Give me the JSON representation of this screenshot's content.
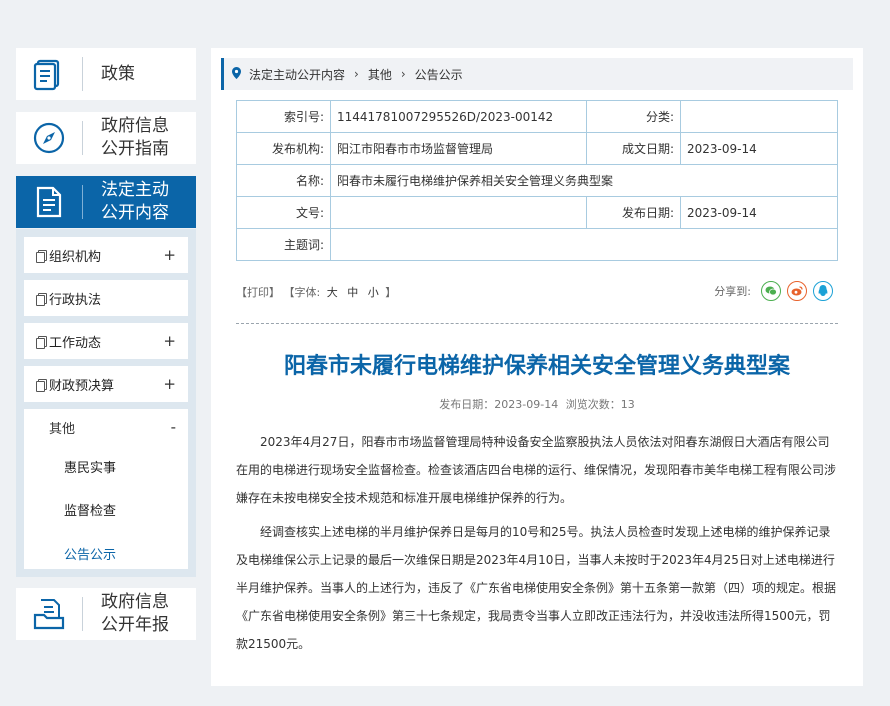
{
  "sidebar": {
    "policy": "政策",
    "guide_l1": "政府信息",
    "guide_l2": "公开指南",
    "active_l1": "法定主动",
    "active_l2": "公开内容",
    "annual_l1": "政府信息",
    "annual_l2": "公开年报",
    "menu": [
      {
        "label": "组织机构",
        "toggle": "+"
      },
      {
        "label": "行政执法",
        "toggle": ""
      },
      {
        "label": "工作动态",
        "toggle": "+"
      },
      {
        "label": "财政预决算",
        "toggle": "+"
      }
    ],
    "open_menu": {
      "label": "其他",
      "toggle": "-",
      "subs": [
        "惠民实事",
        "监督检查",
        "公告公示"
      ]
    }
  },
  "breadcrumb": [
    "法定主动公开内容",
    "其他",
    "公告公示"
  ],
  "meta": {
    "index_label": "索引号:",
    "index_value": "11441781007295526D/2023-00142",
    "category_label": "分类:",
    "category_value": "",
    "publisher_label": "发布机构:",
    "publisher_value": "阳江市阳春市市场监督管理局",
    "created_label": "成文日期:",
    "created_value": "2023-09-14",
    "name_label": "名称:",
    "name_value": "阳春市未履行电梯维护保养相关安全管理义务典型案",
    "docno_label": "文号:",
    "docno_value": "",
    "pubdate_label": "发布日期:",
    "pubdate_value": "2023-09-14",
    "subject_label": "主题词:",
    "subject_value": ""
  },
  "tools": {
    "print": "【打印】",
    "font_open": "【字体:",
    "font_big": "大",
    "font_mid": "中",
    "font_small": "小",
    "font_close": "】",
    "share_label": "分享到:"
  },
  "colors": {
    "accent": "#0b65a8",
    "wechat": "#4caf50",
    "weibo": "#e8622c",
    "qq": "#1ba1d6"
  },
  "article": {
    "title": "阳春市未履行电梯维护保养相关安全管理义务典型案",
    "date": "发布日期：2023-09-14",
    "views": "浏览次数：13",
    "p1": "2023年4月27日，阳春市市场监督管理局特种设备安全监察股执法人员依法对阳春东湖假日大酒店有限公司在用的电梯进行现场安全监督检查。检查该酒店四台电梯的运行、维保情况，发现阳春市美华电梯工程有限公司涉嫌存在未按电梯安全技术规范和标准开展电梯维护保养的行为。",
    "p2": "经调查核实上述电梯的半月维护保养日是每月的10号和25号。执法人员检查时发现上述电梯的维护保养记录及电梯维保公示上记录的最后一次维保日期是2023年4月10日，当事人未按时于2023年4月25日对上述电梯进行半月维护保养。当事人的上述行为，违反了《广东省电梯使用安全条例》第十五条第一款第（四）项的规定。根据《广东省电梯使用安全条例》第三十七条规定，我局责令当事人立即改正违法行为，并没收违法所得1500元，罚款21500元。"
  }
}
